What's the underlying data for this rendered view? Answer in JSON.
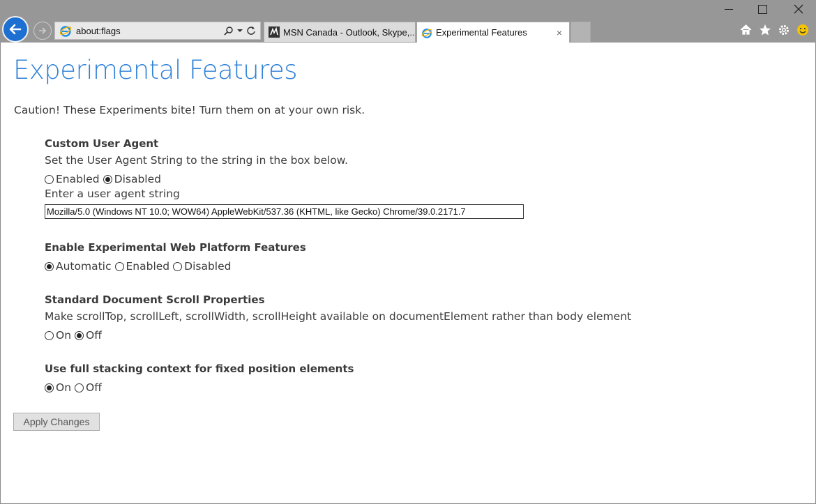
{
  "browser": {
    "address_url": "about:flags",
    "tabs": [
      {
        "label": "MSN Canada - Outlook, Skype,..."
      },
      {
        "label": "Experimental Features",
        "close": "×"
      }
    ]
  },
  "page": {
    "title": "Experimental Features",
    "caution": "Caution! These Experiments bite! Turn them on at your own risk.",
    "features": [
      {
        "title": "Custom User Agent",
        "description": "Set the User Agent String to the string in the box below.",
        "options": [
          {
            "label": "Enabled",
            "selected": false
          },
          {
            "label": "Disabled",
            "selected": true
          }
        ],
        "input_label": "Enter a user agent string",
        "input_value": "Mozilla/5.0 (Windows NT 10.0; WOW64) AppleWebKit/537.36 (KHTML, like Gecko) Chrome/39.0.2171.7"
      },
      {
        "title": "Enable Experimental Web Platform Features",
        "options": [
          {
            "label": "Automatic",
            "selected": true
          },
          {
            "label": "Enabled",
            "selected": false
          },
          {
            "label": "Disabled",
            "selected": false
          }
        ]
      },
      {
        "title": "Standard Document Scroll Properties",
        "description": "Make scrollTop, scrollLeft, scrollWidth, scrollHeight available on documentElement rather than body element",
        "options": [
          {
            "label": "On",
            "selected": false
          },
          {
            "label": "Off",
            "selected": true
          }
        ]
      },
      {
        "title": "Use full stacking context for fixed position elements",
        "options": [
          {
            "label": "On",
            "selected": true
          },
          {
            "label": "Off",
            "selected": false
          }
        ]
      }
    ],
    "apply_label": "Apply Changes"
  },
  "colors": {
    "accent": "#2e80d8",
    "chrome": "#979797",
    "back_button": "#1e6fd2"
  }
}
